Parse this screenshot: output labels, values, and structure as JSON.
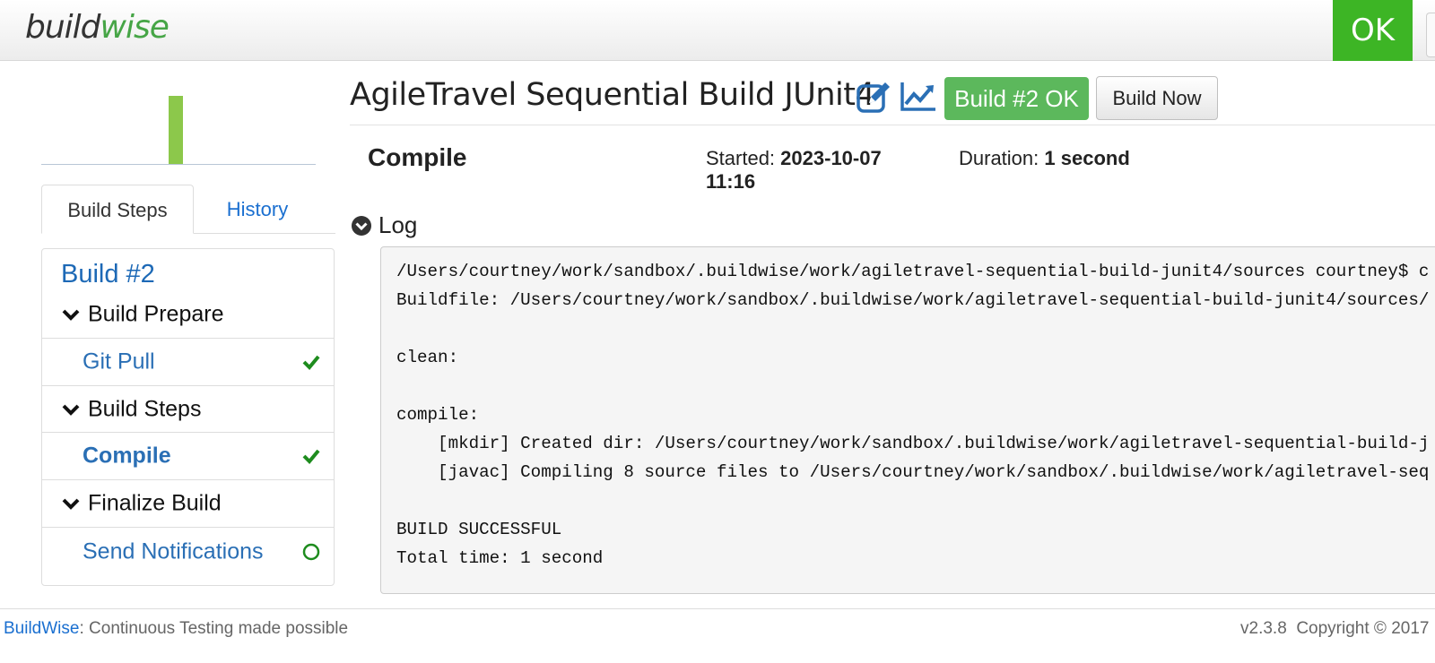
{
  "header": {
    "logo_part1": "build",
    "logo_part2": "wise",
    "status": "OK",
    "colors": {
      "ok": "#3db525",
      "logo_accent": "#46a546"
    }
  },
  "sidebar": {
    "history_chart": {
      "bars": [
        {
          "label": "Build #2",
          "status": "OK",
          "value": 1
        }
      ],
      "bar_color": "#8cc84b"
    },
    "tabs": [
      {
        "label": "Build Steps",
        "active": true
      },
      {
        "label": "History",
        "active": false
      }
    ],
    "panel_title": "Build #2",
    "groups": [
      {
        "label": "Build Prepare",
        "icon": "chevron-down-icon",
        "steps": [
          {
            "label": "Git Pull",
            "status": "passed",
            "icon": "check-icon"
          }
        ]
      },
      {
        "label": "Build Steps",
        "icon": "chevron-down-icon",
        "steps": [
          {
            "label": "Compile",
            "status": "passed",
            "icon": "check-icon",
            "current": true
          }
        ]
      },
      {
        "label": "Finalize Build",
        "icon": "chevron-down-icon",
        "steps": [
          {
            "label": "Send Notifications",
            "status": "pending",
            "icon": "circle-icon"
          }
        ]
      }
    ]
  },
  "main": {
    "title": "AgileTravel Sequential Build JUnit4",
    "icons": [
      "edit-icon",
      "line-chart-icon"
    ],
    "build_badge": "Build #2 OK",
    "build_now": "Build Now",
    "step": {
      "name": "Compile",
      "started_label": "Started:",
      "started_value": "2023-10-07 11:16",
      "duration_label": "Duration:",
      "duration_value": "1 second"
    },
    "log": {
      "label": "Log",
      "toggle_icon": "chevron-circle-down-icon",
      "lines": [
        "/Users/courtney/work/sandbox/.buildwise/work/agiletravel-sequential-build-junit4/sources courtney$ c",
        "Buildfile: /Users/courtney/work/sandbox/.buildwise/work/agiletravel-sequential-build-junit4/sources/",
        "",
        "clean:",
        "",
        "compile:",
        "    [mkdir] Created dir: /Users/courtney/work/sandbox/.buildwise/work/agiletravel-sequential-build-j",
        "    [javac] Compiling 8 source files to /Users/courtney/work/sandbox/.buildwise/work/agiletravel-seq",
        "",
        "BUILD SUCCESSFUL",
        "Total time: 1 second"
      ]
    }
  },
  "footer": {
    "brand": "BuildWise",
    "tagline": ": Continuous Testing made possible",
    "version": "v2.3.8",
    "copyright": "Copyright © 2017"
  }
}
